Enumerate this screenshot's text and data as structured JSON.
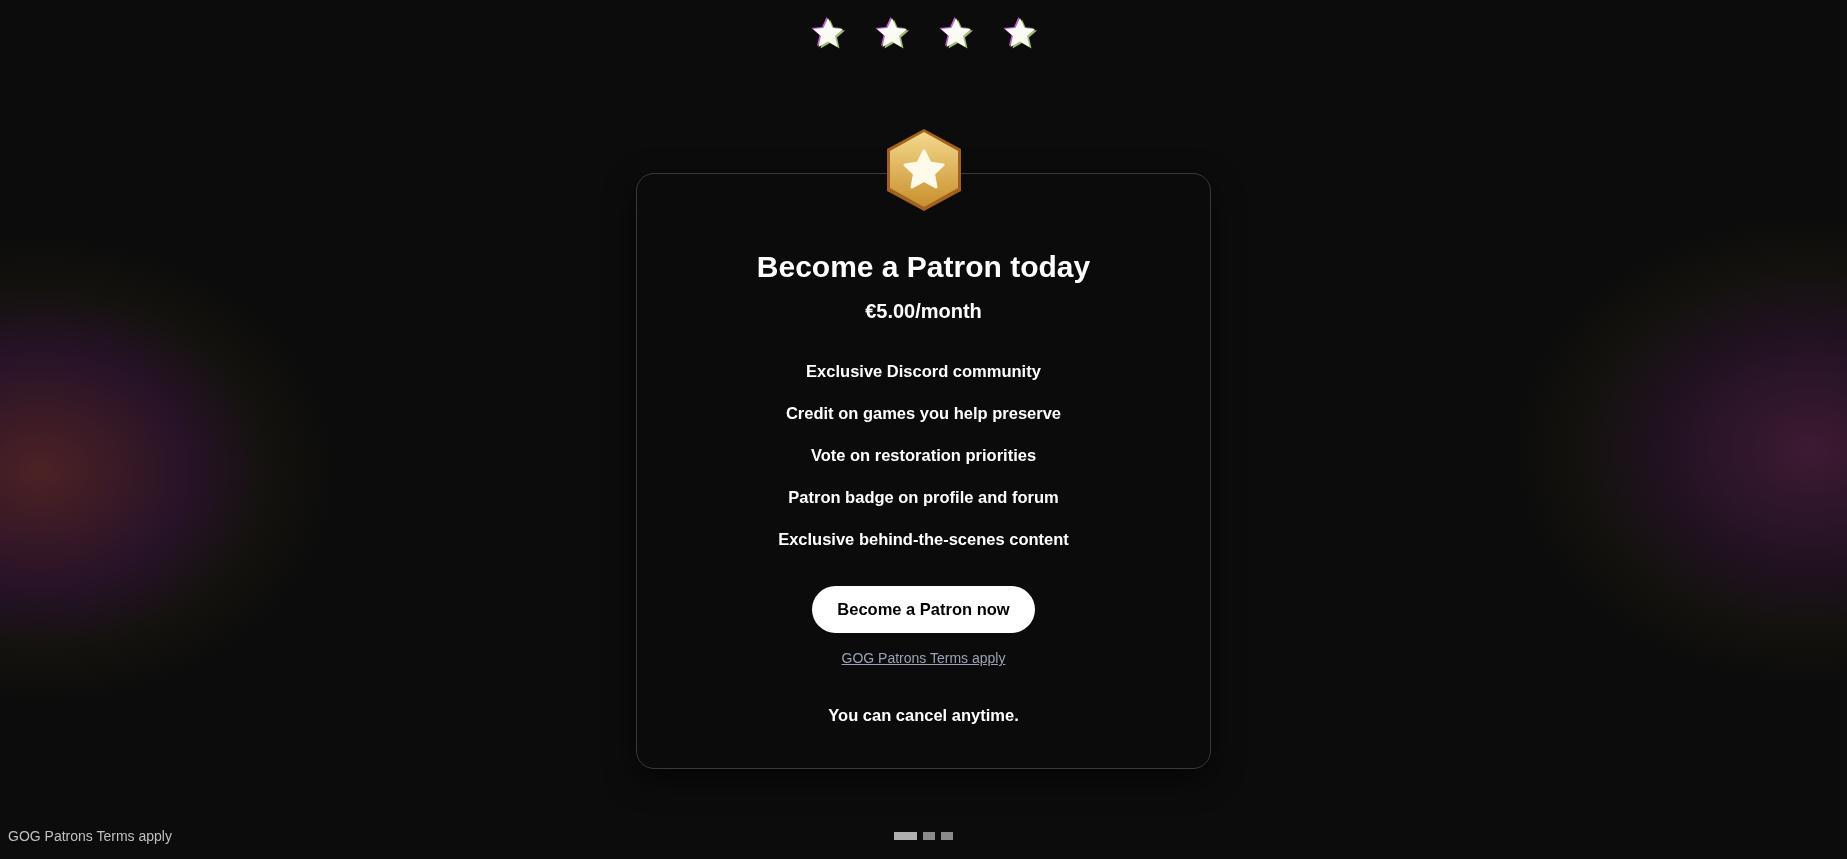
{
  "decor_stars": [
    {
      "kind": "star"
    },
    {
      "kind": "star"
    },
    {
      "kind": "star"
    },
    {
      "kind": "star"
    }
  ],
  "offer": {
    "title": "Become a Patron today",
    "price": "€5.00/month",
    "benefits": [
      "Exclusive Discord community",
      "Credit on games you help preserve",
      "Vote on restoration priorities",
      "Patron badge on profile and forum",
      "Exclusive behind-the-scenes content"
    ],
    "button": "Become a Patron now",
    "terms_link": "GOG Patrons Terms apply",
    "note": "You can cancel anytime."
  },
  "footer": {
    "terms": "GOG Patrons Terms apply"
  },
  "pager": [
    {
      "selected": true
    },
    {
      "selected": false
    },
    {
      "selected": false
    }
  ]
}
